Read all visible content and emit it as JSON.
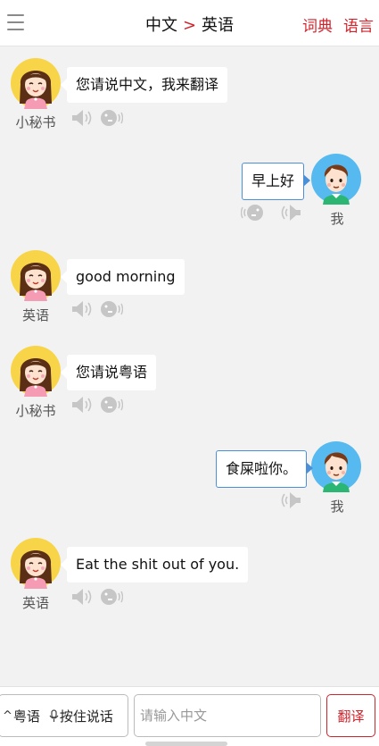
{
  "header": {
    "source_lang": "中文",
    "arrow": ">",
    "target_lang": "英语",
    "dictionary_link": "词典",
    "language_link": "语言"
  },
  "messages": [
    {
      "side": "left",
      "avatar": "girl-avatar",
      "sender": "小秘书",
      "text": "您请说中文，我来翻译"
    },
    {
      "side": "right",
      "avatar": "boy-avatar",
      "sender": "我",
      "text": "早上好"
    },
    {
      "side": "left",
      "avatar": "girl-avatar",
      "sender": "英语",
      "text": "good morning"
    },
    {
      "side": "left",
      "avatar": "girl-avatar",
      "sender": "小秘书",
      "text": "您请说粤语"
    },
    {
      "side": "right",
      "avatar": "boy-avatar",
      "sender": "我",
      "text": "食屎啦你。"
    },
    {
      "side": "left",
      "avatar": "girl-avatar",
      "sender": "英语",
      "text": "Eat the shit out of you."
    }
  ],
  "icons": {
    "menu": "hamburger-menu-icon",
    "speaker": "speaker-icon",
    "talking_head": "talking-head-icon",
    "mic": "microphone-icon",
    "chevron": "chevron-up-icon"
  },
  "input_bar": {
    "language_toggle": "粤语",
    "voice_button": "按住说话",
    "input_placeholder": "请输入中文",
    "translate_button": "翻译"
  },
  "colors": {
    "accent_red": "#d0232b",
    "bubble_border_blue": "#4b8fd8",
    "background": "#f2f2f2",
    "icon_gray": "#c6c6c6"
  }
}
